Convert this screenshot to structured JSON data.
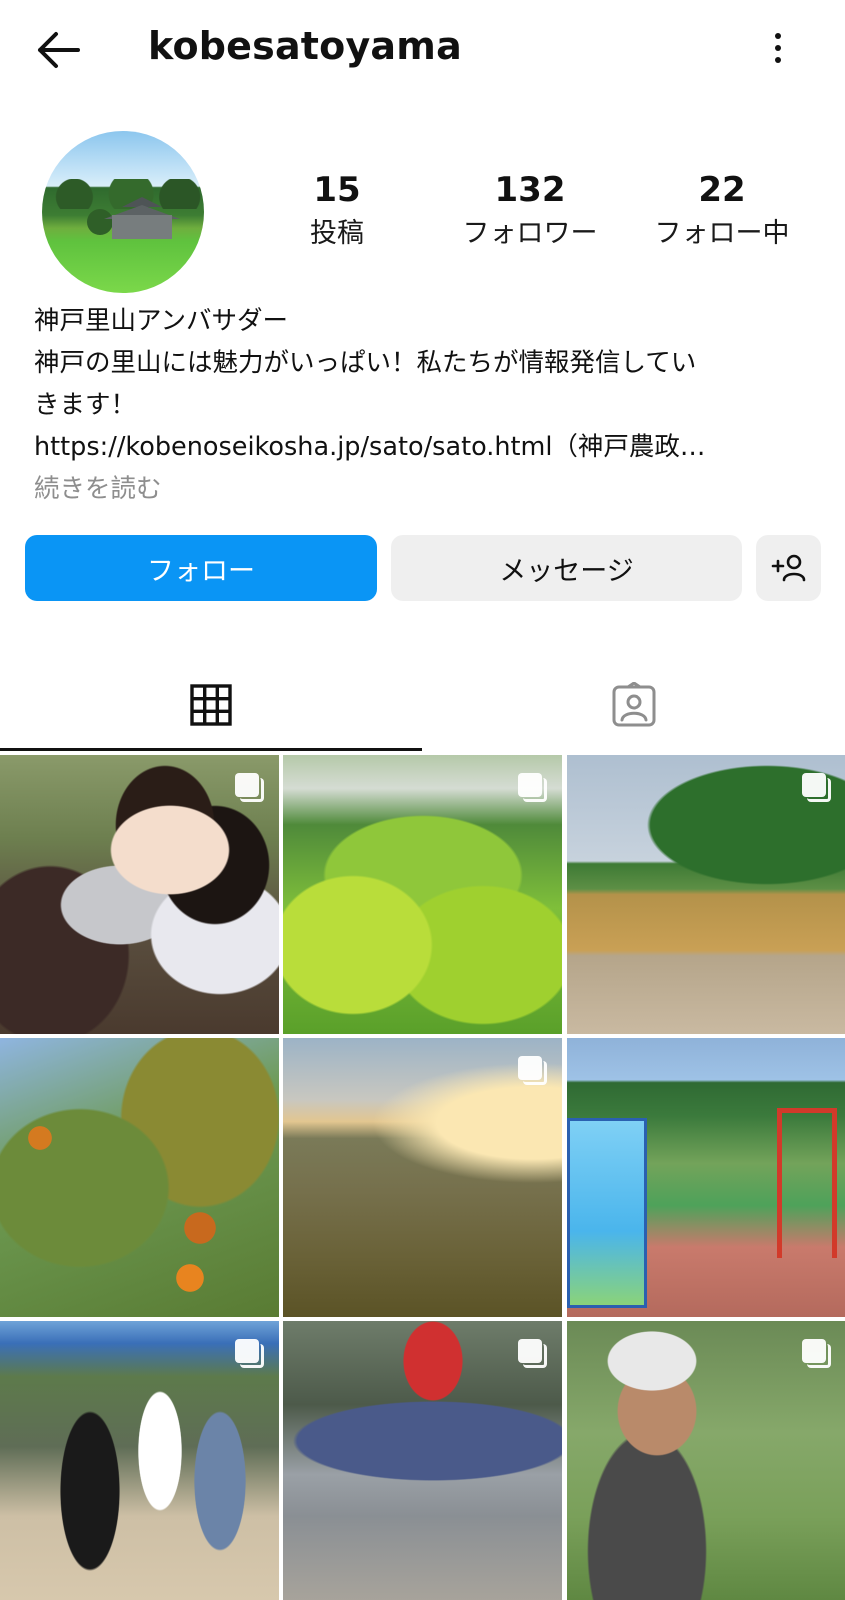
{
  "header": {
    "username": "kobesatoyama",
    "back_icon": "arrow-left-icon",
    "more_icon": "more-vertical-icon"
  },
  "profile": {
    "stats": [
      {
        "value": "15",
        "label": "投稿"
      },
      {
        "value": "132",
        "label": "フォロワー"
      },
      {
        "value": "22",
        "label": "フォロー中"
      }
    ],
    "bio_lines": [
      "神戸里山アンバサダー",
      "神戸の里山には魅力がいっぱい！私たちが情報発信してい",
      "きます！",
      "https://kobenoseikosha.jp/sato/sato.html（神戸農政…"
    ],
    "read_more": "続きを読む"
  },
  "actions": {
    "follow_label": "フォロー",
    "message_label": "メッセージ",
    "add_user_icon": "add-person-icon",
    "accent_color": "#0a95f5"
  },
  "tabs": [
    {
      "icon": "grid-icon",
      "active": true
    },
    {
      "icon": "tagged-person-icon",
      "active": false
    }
  ],
  "posts": [
    {
      "multi": true
    },
    {
      "multi": true
    },
    {
      "multi": true
    },
    {
      "multi": false
    },
    {
      "multi": true
    },
    {
      "multi": false
    },
    {
      "multi": true
    },
    {
      "multi": true
    },
    {
      "multi": true
    }
  ]
}
